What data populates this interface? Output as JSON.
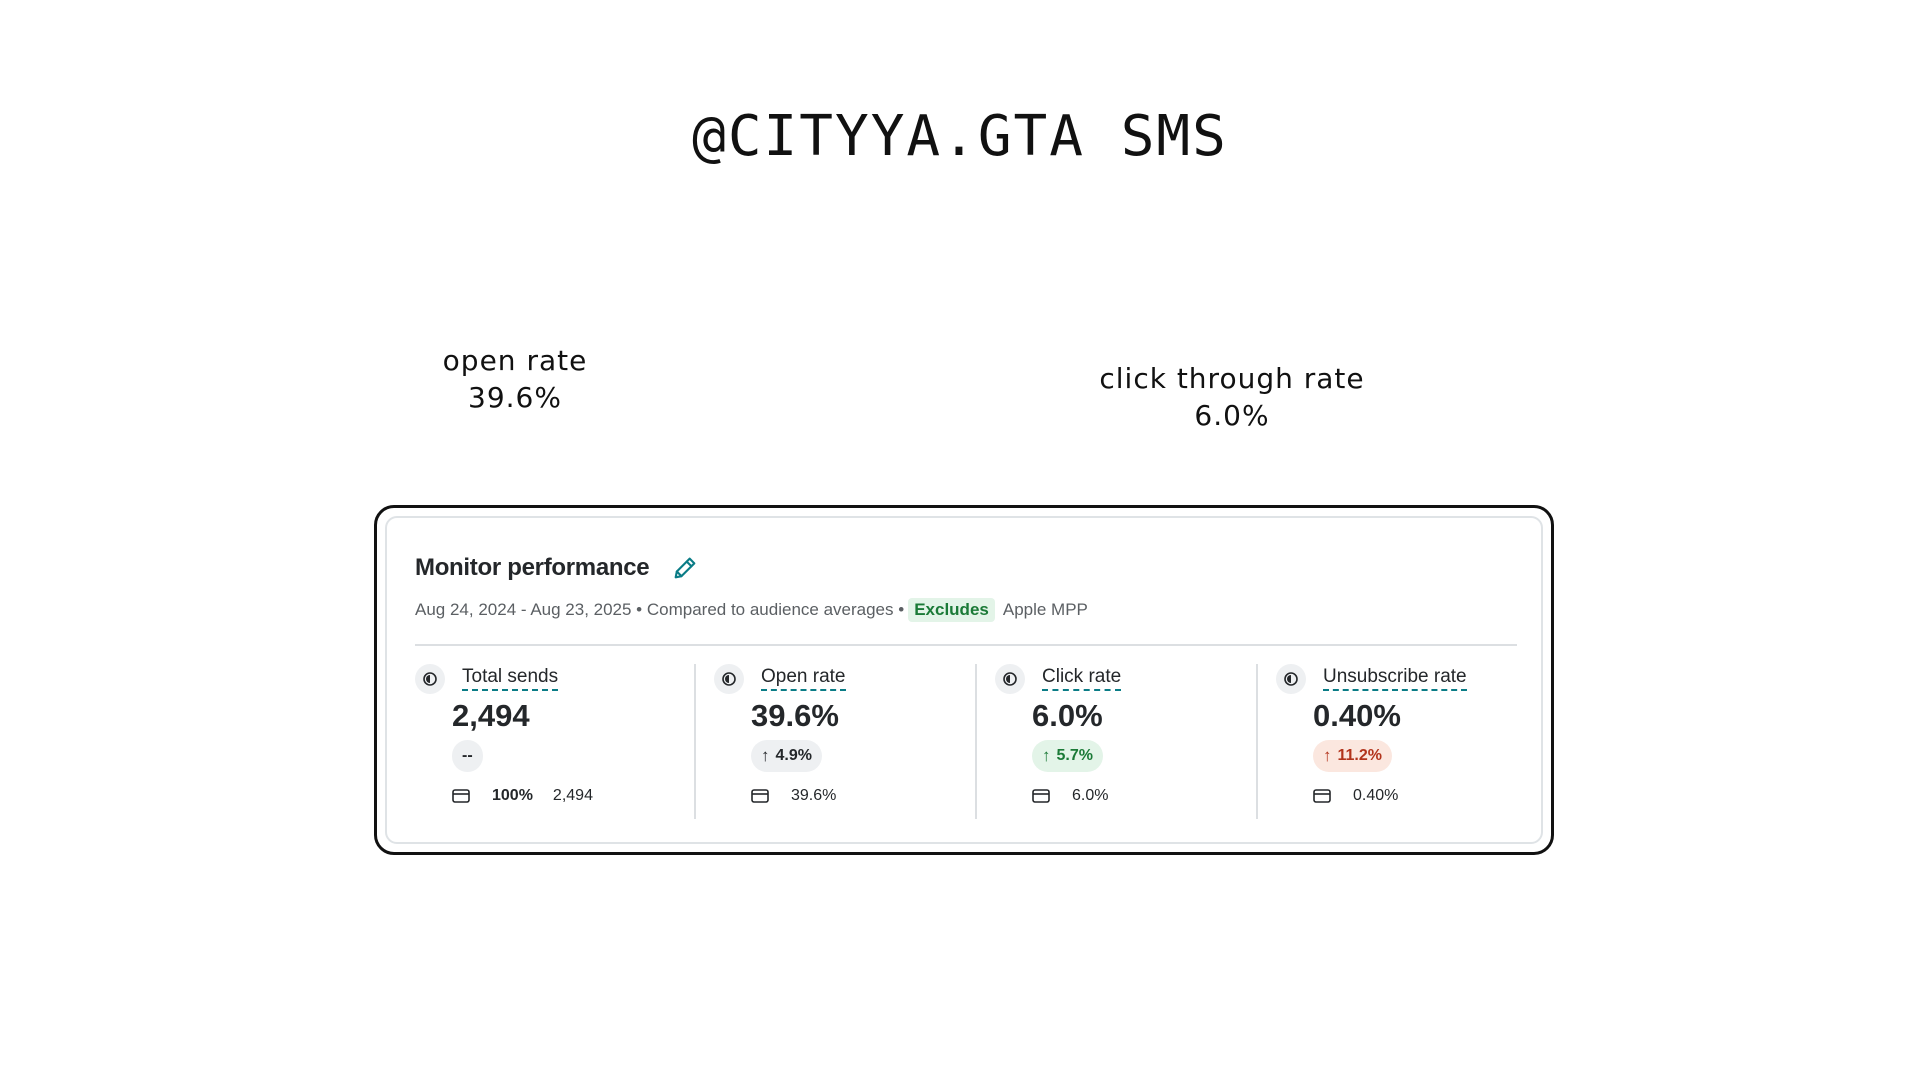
{
  "header": {
    "title": "@CITYYA.GTA SMS"
  },
  "callouts": {
    "open": {
      "label": "open rate",
      "value": "39.6%"
    },
    "click": {
      "label": "click through rate",
      "value": "6.0%"
    }
  },
  "panel": {
    "title": "Monitor performance",
    "subtitle": "Aug 24, 2024 - Aug 23, 2025 • Compared to audience averages •",
    "excludes_badge": "Excludes",
    "excludes_target": "Apple MPP",
    "metrics": [
      {
        "label": "Total sends",
        "value": "2,494",
        "change": "--",
        "detail_pct": "100%",
        "detail_value": "2,494"
      },
      {
        "label": "Open rate",
        "value": "39.6%",
        "arrow": "↑",
        "change": "4.9%",
        "detail_value": "39.6%"
      },
      {
        "label": "Click rate",
        "value": "6.0%",
        "arrow": "↑",
        "change": "5.7%",
        "detail_value": "6.0%"
      },
      {
        "label": "Unsubscribe rate",
        "value": "0.40%",
        "arrow": "↑",
        "change": "11.2%",
        "detail_value": "0.40%"
      }
    ]
  },
  "colors": {
    "accent_teal": "#0a7c86",
    "positive_green": "#1b7a37",
    "negative_red": "#b2341c"
  }
}
